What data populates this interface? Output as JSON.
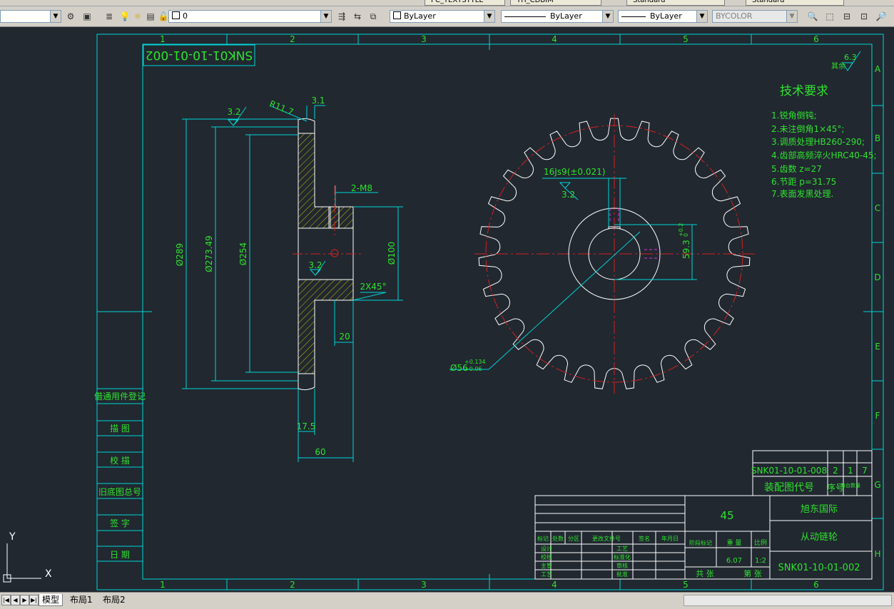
{
  "top_tabs": [
    "PC_TEXTSTYLE",
    "TH_CDBIM",
    "Standard",
    "Standard"
  ],
  "toolbar": {
    "layer_value": "0",
    "color_value": "ByLayer",
    "linetype_value": "ByLayer",
    "lineweight_value": "ByLayer",
    "plotstyle_value": "BYCOLOR"
  },
  "frame": {
    "col_labels": [
      "1",
      "2",
      "3",
      "4",
      "5",
      "6"
    ],
    "row_labels": [
      "A",
      "B",
      "C",
      "D",
      "E",
      "F",
      "G",
      "H"
    ],
    "left_block": [
      "借通用件登记",
      "描 图",
      "校 描",
      "旧底图总号",
      "签 字",
      "日 期"
    ]
  },
  "drawing": {
    "stamp": "SNK01-10-01-002",
    "roughness_other": "其余",
    "roughness_main": "6.3",
    "tech_title": "技术要求",
    "tech_items": [
      "1.锐角倒钝;",
      "2.未注倒角1×45°;",
      "3.调质处理HB260-290;",
      "4.齿部高频淬火HRC40-45;",
      "5.齿数  z=27",
      "6.节距  p=31.75",
      "7.表面发黑处理."
    ],
    "dims": {
      "r11": "R11.7",
      "d31": "3.1",
      "rough_32": "3.2",
      "m8": "2-M8",
      "d289": "Ø289",
      "d273": "Ø273.49",
      "d254": "Ø254",
      "d100": "Ø100",
      "chamfer": "2X45°",
      "d20": "20",
      "d175": "17.5",
      "d60": "60",
      "key": "16Js9(±0.021)",
      "d593": "59.3",
      "d593_tol_up": "+0.2",
      "d593_tol_lo": "0",
      "d56": "Ø56",
      "d56_tol_up": "+0.134",
      "d56_tol_lo": "+0.06"
    }
  },
  "title_block": {
    "assembly_code": "SNK01-10-01-008",
    "seq": "2",
    "qty": "1",
    "total": "7",
    "assembly_label": "装配图代号",
    "seq_label": "序号",
    "qty_label": "每台数量",
    "material": "45",
    "company": "旭东国际",
    "part_name": "从动链轮",
    "drawing_no": "SNK01-10-01-002",
    "weight": "6.07",
    "scale": "1:2",
    "stage_label": "阶段标记",
    "weight_label": "重 量",
    "scale_label": "比例",
    "sheets_label": "共  张",
    "sheet_label": "第  张",
    "rev_headers": [
      "标记",
      "处数",
      "分区",
      "更改文件号",
      "签名",
      "年月日"
    ],
    "row_labels_left": [
      "设计",
      "校核",
      "主管",
      "工艺"
    ],
    "row_labels_mid": [
      "工艺",
      "标准化",
      "审核",
      "批准"
    ]
  },
  "ucs": {
    "y": "Y",
    "x": "X"
  },
  "bottom_tabs": {
    "model": "模型",
    "layout1": "布局1",
    "layout2": "布局2"
  },
  "colors": {
    "cyan": "#00d6d6",
    "green": "#2fe22f",
    "white": "#ffffff",
    "red": "#d42020",
    "yellow": "#c8c400",
    "magenta": "#e030e0",
    "bg": "#212830"
  }
}
